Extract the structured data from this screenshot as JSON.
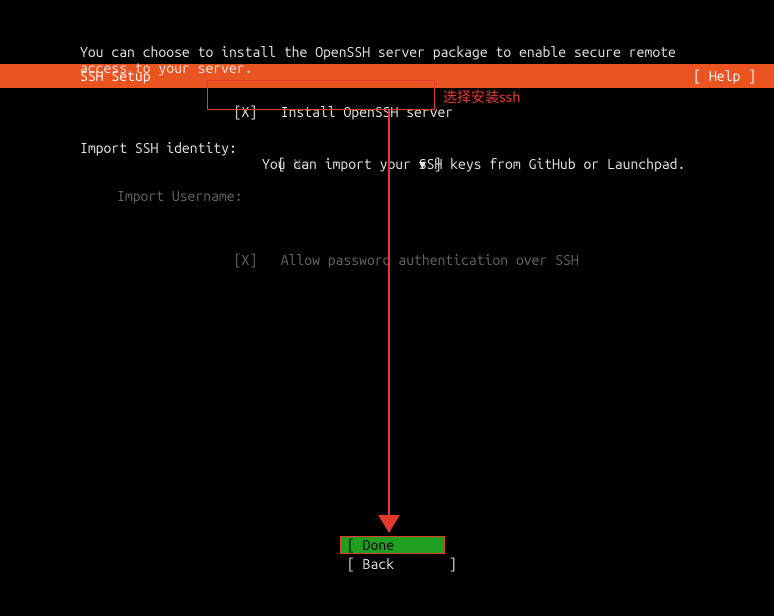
{
  "header": {
    "title": "SSH Setup",
    "help": "[ Help ]"
  },
  "intro": {
    "line1": "You can choose to install the OpenSSH server package to enable secure remote",
    "line2": "access to your server."
  },
  "install": {
    "checkbox": "[X]",
    "label": "Install OpenSSH server"
  },
  "annotation": "选择安装ssh",
  "identity": {
    "label": "Import SSH identity:",
    "open": "[",
    "value": "No",
    "arrow": "▾",
    "close": "]",
    "help": "You can import your SSH keys from GitHub or Launchpad."
  },
  "username_label": "Import Username:",
  "allow_pw": {
    "checkbox": "[X]",
    "label": "Allow password authentication over SSH"
  },
  "buttons": {
    "done": "[ Done       ]",
    "back": "[ Back       ]"
  }
}
